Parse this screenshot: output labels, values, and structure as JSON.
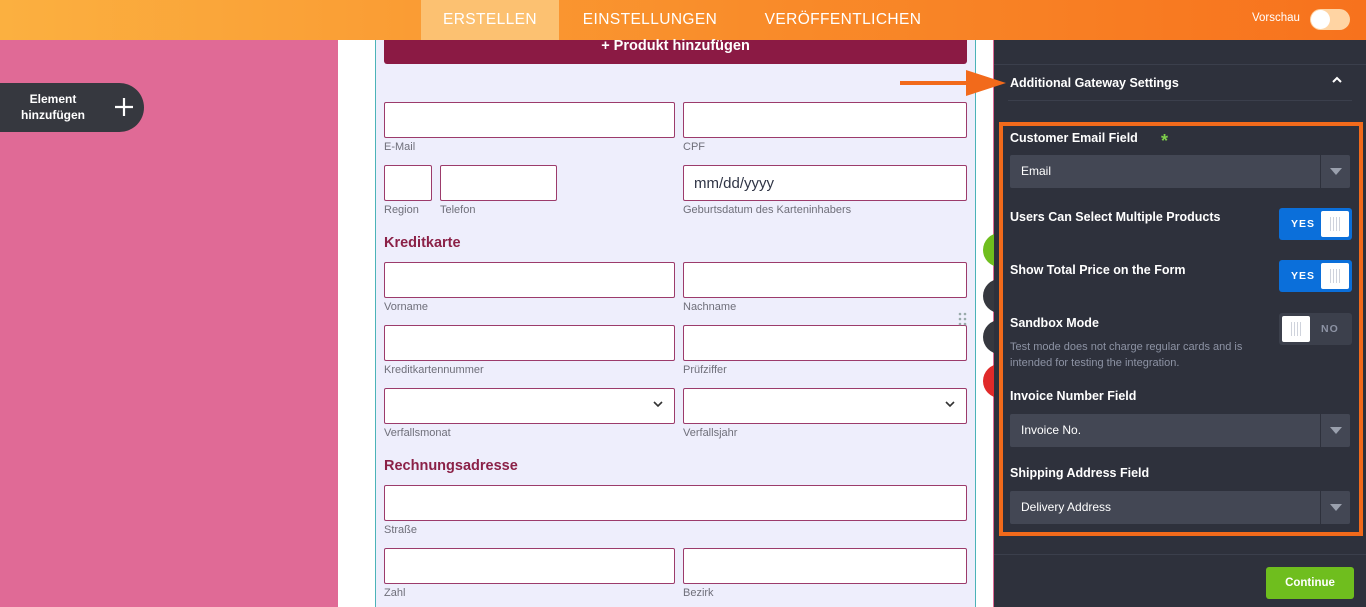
{
  "nav": {
    "tabs": [
      {
        "label": "ERSTELLEN"
      },
      {
        "label": "EINSTELLUNGEN"
      },
      {
        "label": "VERÖFFENTLICHEN"
      }
    ],
    "preview_label": "Vorschau"
  },
  "sidebar": {
    "add_element_label": "Element hinzufügen",
    "add_icon": "plus-icon"
  },
  "form": {
    "add_product_label": "+ Produkt hinzufügen",
    "fields": {
      "email": "E-Mail",
      "cpf": "CPF",
      "region": "Region",
      "phone": "Telefon",
      "birthdate_placeholder": "mm/dd/yyyy",
      "birthdate": "Geburtsdatum des Karteninhabers",
      "firstname": "Vorname",
      "lastname": "Nachname",
      "cardnumber": "Kreditkartennummer",
      "cvv": "Prüfziffer",
      "exp_month": "Verfallsmonat",
      "exp_year": "Verfallsjahr",
      "street": "Straße",
      "number": "Zahl",
      "district": "Bezirk"
    },
    "sections": {
      "credit_card": "Kreditkarte",
      "billing_address": "Rechnungsadresse"
    }
  },
  "panel": {
    "header_title": "Additional Gateway Settings",
    "customer_email": {
      "label": "Customer Email Field",
      "required_mark": "*",
      "value": "Email"
    },
    "multiple_products": {
      "label": "Users Can Select Multiple Products",
      "state": "YES"
    },
    "total_price": {
      "label": "Show Total Price on the Form",
      "state": "YES"
    },
    "sandbox": {
      "label": "Sandbox Mode",
      "state": "NO",
      "description": "Test mode does not charge regular cards and is intended for testing the integration."
    },
    "invoice_number": {
      "label": "Invoice Number Field",
      "value": "Invoice No."
    },
    "shipping_address": {
      "label": "Shipping Address Field",
      "value": "Delivery Address"
    },
    "continue_label": "Continue"
  },
  "colors": {
    "accent_orange": "#f26a1b",
    "brand_maroon": "#8b1a44",
    "toggle_blue": "#0b6fda",
    "continue_green": "#6fbe1e",
    "panel_bg": "#2e313c",
    "left_pink": "#e06a96"
  }
}
